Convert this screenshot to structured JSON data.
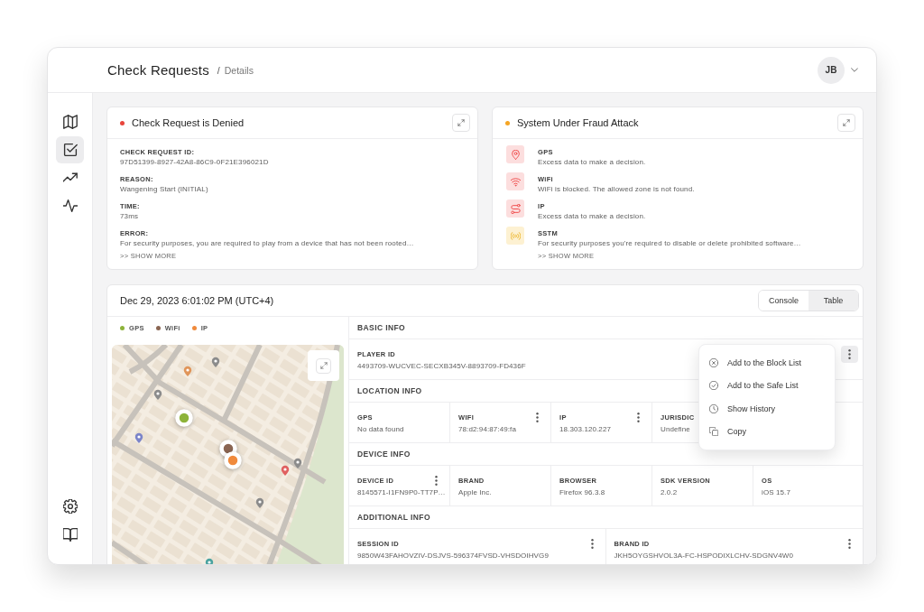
{
  "header": {
    "title": "Check Requests",
    "separator": "/",
    "current": "Details",
    "avatar": {
      "initials": "JB"
    }
  },
  "sidebar": {
    "items": [
      {
        "kind": "map",
        "selected": false
      },
      {
        "kind": "checklist",
        "selected": true
      },
      {
        "kind": "trend",
        "selected": false
      },
      {
        "kind": "activity",
        "selected": false
      }
    ],
    "footer_items": [
      {
        "kind": "settings",
        "selected": false
      },
      {
        "kind": "book",
        "selected": false
      }
    ]
  },
  "cards": [
    {
      "kind": "details",
      "title": "Check Request is Denied",
      "color": "#e8453c",
      "fields": [
        {
          "label": "CHECK REQUEST ID:",
          "value": "97D51399-8927-42A8-86C9-0F21E396021D"
        },
        {
          "label": "REASON:",
          "value": "Wangening Start (INITIAL)"
        },
        {
          "label": "TIME:",
          "value": "73ms"
        },
        {
          "label": "ERROR:",
          "value": "For security purposes, you are required to play from a device that has not been rooted…"
        }
      ],
      "show_more": ">> SHOW MORE"
    },
    {
      "kind": "alerts",
      "title": "System Under Fraud Attack",
      "color": "#f5a524",
      "alerts": [
        {
          "kind": "location",
          "title": "GPS",
          "text": "Excess data to make a decision.",
          "color": "#fcdede"
        },
        {
          "kind": "wifi",
          "title": "WiFi",
          "text": "WiFi is blocked. The allowed zone is not found.",
          "color": "#fcdede"
        },
        {
          "kind": "route",
          "title": "IP",
          "text": "Excess data to make a decision.",
          "color": "#fcdede"
        },
        {
          "kind": "broadcast",
          "title": "SSTM",
          "text": "For security purposes you're required to disable or delete prohibited software…",
          "color": "#fdf1d2"
        }
      ],
      "show_more": ">> SHOW MORE"
    }
  ],
  "panel": {
    "timestamp": "Dec 29, 2023 6:01:02 PM (UTC+4)",
    "views": [
      {
        "label": "Console",
        "selected": false
      },
      {
        "label": "Table",
        "selected": true
      }
    ],
    "legend": [
      {
        "label": "GPS",
        "color": "#8db33a"
      },
      {
        "label": "WiFi",
        "color": "#8a6552"
      },
      {
        "label": "IP",
        "color": "#f08a3c"
      }
    ],
    "sections": [
      {
        "title": "BASIC INFO",
        "fields": [
          {
            "label": "PLAYER ID",
            "value": "4493709-WUCVEC-SECXB345V-8893709-FD436F",
            "actions": {
              "expanded": true,
              "items": [
                {
                  "kind": "block",
                  "label": "Add to the Block List"
                },
                {
                  "kind": "safe",
                  "label": "Add to the Safe List"
                },
                {
                  "kind": "history",
                  "label": "Show History"
                },
                {
                  "kind": "copy",
                  "label": "Copy"
                }
              ]
            }
          }
        ]
      },
      {
        "title": "LOCATION INFO",
        "fields": [
          {
            "label": "GPS",
            "value": "No data found"
          },
          {
            "label": "WIFI",
            "value": "78:d2:94:87:49:fa",
            "actions": {
              "expanded": false
            }
          },
          {
            "label": "IP",
            "value": "18.303.120.227",
            "actions": {
              "expanded": false
            }
          },
          {
            "label": "JURISDIC",
            "value": "Undefine"
          }
        ]
      },
      {
        "title": "DEVICE INFO",
        "fields": [
          {
            "label": "DEVICE ID",
            "value": "8145571-I1FN9P0-TT7P…",
            "actions": {
              "expanded": false
            }
          },
          {
            "label": "BRAND",
            "value": "Apple Inc."
          },
          {
            "label": "BROWSER",
            "value": "Firefox 96.3.8"
          },
          {
            "label": "SDK VERSION",
            "value": "2.0.2"
          },
          {
            "label": "OS",
            "value": "iOS 15.7"
          }
        ]
      },
      {
        "title": "ADDITIONAL INFO",
        "fields": [
          {
            "label": "SESSION ID",
            "value": "9850W43FAHOVZIV-DSJVS-596374FVSD-VHSDOIHVG9",
            "actions": {
              "expanded": false
            }
          },
          {
            "label": "BRAND ID",
            "value": "JKH5OYGSHVOL3A-FC-HSPODIXLCHV-SDGNV4W0",
            "actions": {
              "expanded": false
            }
          }
        ]
      }
    ]
  }
}
